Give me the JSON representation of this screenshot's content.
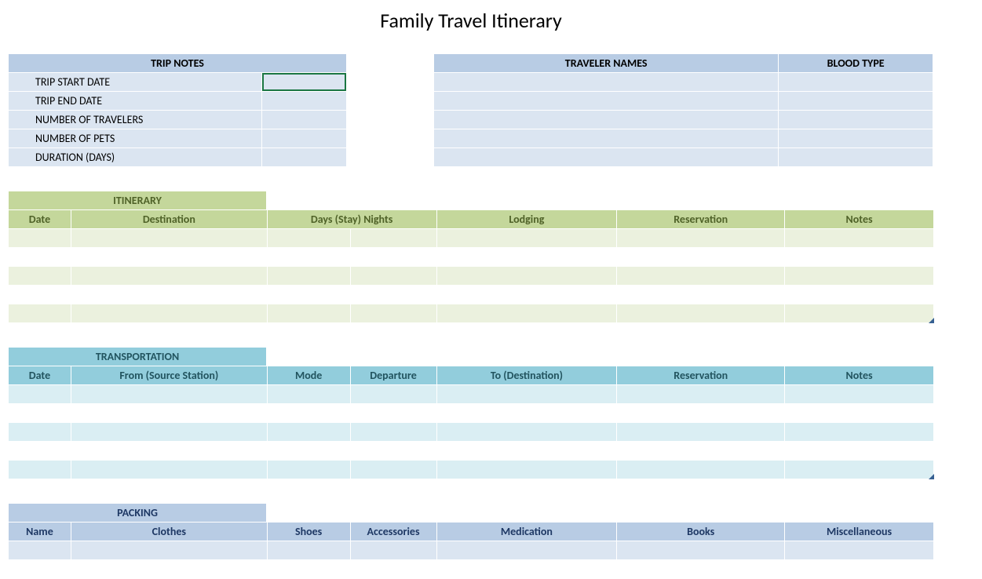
{
  "title": "Family Travel Itinerary",
  "trip_notes": {
    "header": "TRIP NOTES",
    "rows": [
      {
        "label": "TRIP START DATE",
        "value": ""
      },
      {
        "label": "TRIP END DATE",
        "value": ""
      },
      {
        "label": "NUMBER OF TRAVELERS",
        "value": ""
      },
      {
        "label": "NUMBER OF PETS",
        "value": ""
      },
      {
        "label": "DURATION (DAYS)",
        "value": ""
      }
    ]
  },
  "travelers": {
    "name_header": "TRAVELER NAMES",
    "blood_header": "BLOOD TYPE",
    "rows": [
      {
        "name": "",
        "blood": ""
      },
      {
        "name": "",
        "blood": ""
      },
      {
        "name": "",
        "blood": ""
      },
      {
        "name": "",
        "blood": ""
      },
      {
        "name": "",
        "blood": ""
      }
    ]
  },
  "itinerary": {
    "title": "ITINERARY",
    "cols": [
      "Date",
      "Destination",
      "Days (Stay) Nights",
      "Lodging",
      "Reservation",
      "Notes"
    ]
  },
  "transportation": {
    "title": "TRANSPORTATION",
    "cols": [
      "Date",
      "From (Source Station)",
      "Mode",
      "Departure",
      "To (Destination)",
      "Reservation",
      "Notes"
    ]
  },
  "packing": {
    "title": "PACKING",
    "cols": [
      "Name",
      "Clothes",
      "Shoes",
      "Accessories",
      "Medication",
      "Books",
      "Miscellaneous"
    ]
  }
}
